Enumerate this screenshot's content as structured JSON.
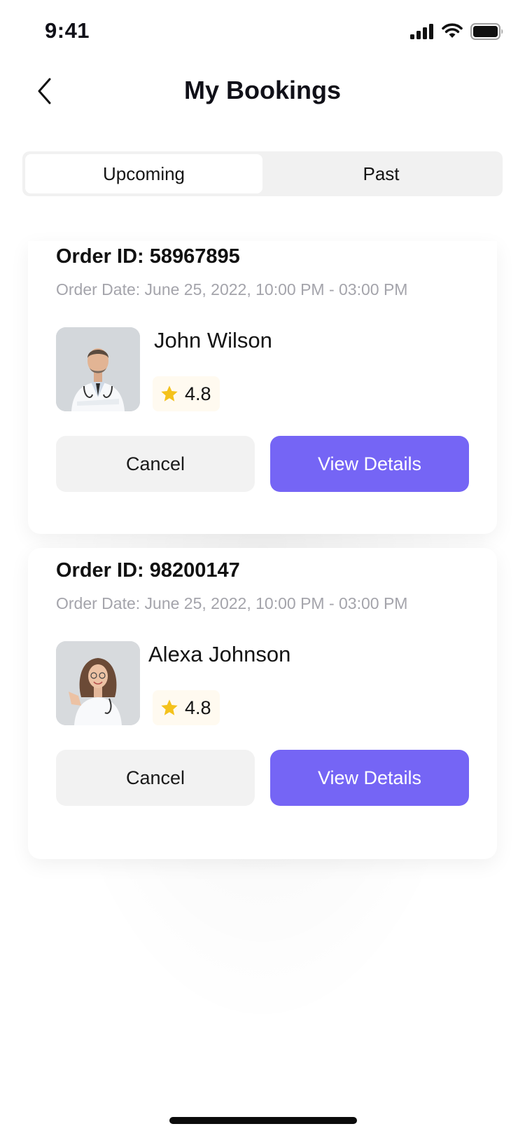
{
  "status_bar": {
    "time": "9:41"
  },
  "header": {
    "title": "My Bookings"
  },
  "tabs": [
    {
      "label": "Upcoming",
      "active": true
    },
    {
      "label": "Past",
      "active": false
    }
  ],
  "bookings": [
    {
      "order_id": "Order ID: 58967895",
      "order_date": "Order Date: June 25, 2022, 10:00 PM - 03:00 PM",
      "doctor_name": "John Wilson",
      "rating": "4.8",
      "cancel_label": "Cancel",
      "view_label": "View Details"
    },
    {
      "order_id": "Order ID: 98200147",
      "order_date": "Order Date: June 25, 2022, 10:00 PM - 03:00 PM",
      "doctor_name": "Alexa Johnson",
      "rating": "4.8",
      "cancel_label": "Cancel",
      "view_label": "View Details"
    }
  ],
  "colors": {
    "accent": "#7565f5",
    "star": "#f4c21c",
    "muted_text": "#a4a4ab",
    "tab_bg": "#f1f1f1"
  },
  "icons": {
    "back": "chevron-left-icon",
    "signal": "signal-icon",
    "wifi": "wifi-icon",
    "battery": "battery-icon",
    "star": "star-icon"
  }
}
